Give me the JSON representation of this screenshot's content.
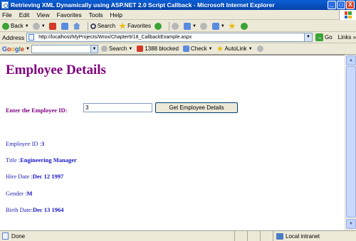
{
  "window": {
    "title": "Retrieving XML Dynamically using ASP.NET 2.0 Script Callback - Microsoft Internet Explorer",
    "controls": [
      "_",
      "□",
      "X"
    ]
  },
  "menu": [
    "File",
    "Edit",
    "View",
    "Favorites",
    "Tools",
    "Help"
  ],
  "toolbar": {
    "back_label": "Back",
    "search_label": "Search",
    "favorites_label": "Favorites"
  },
  "address": {
    "label": "Address",
    "url": "http://localhost/MyProjects/Wrox/Chapter9/18_CallbackExample.aspx",
    "go_label": "Go",
    "links_label": "Links"
  },
  "google": {
    "logo_letters": [
      "G",
      "o",
      "o",
      "g",
      "l",
      "e"
    ],
    "search_label": "Search",
    "blocked_label": "1388 blocked",
    "check_label": "Check",
    "autolink_label": "AutoLink"
  },
  "page": {
    "title": "Employee Details",
    "input_label": "Enter the Employee ID:",
    "input_value": "3",
    "button_label": "Get Employee Details",
    "fields": [
      {
        "label": "Employee ID :",
        "value": "3"
      },
      {
        "label": "Title :",
        "value": "Engineering Manager"
      },
      {
        "label": "Hire Date :",
        "value": "Dec 12 1997"
      },
      {
        "label": "Gender :",
        "value": "M"
      },
      {
        "label": "Birth Date:",
        "value": "Dec 13 1964"
      }
    ]
  },
  "status": {
    "text": "Done",
    "zone": "Local intranet"
  },
  "colors": {
    "heading": "#800080",
    "field_text": "#1f1fb5",
    "titlebar": "#0a5fd6"
  }
}
